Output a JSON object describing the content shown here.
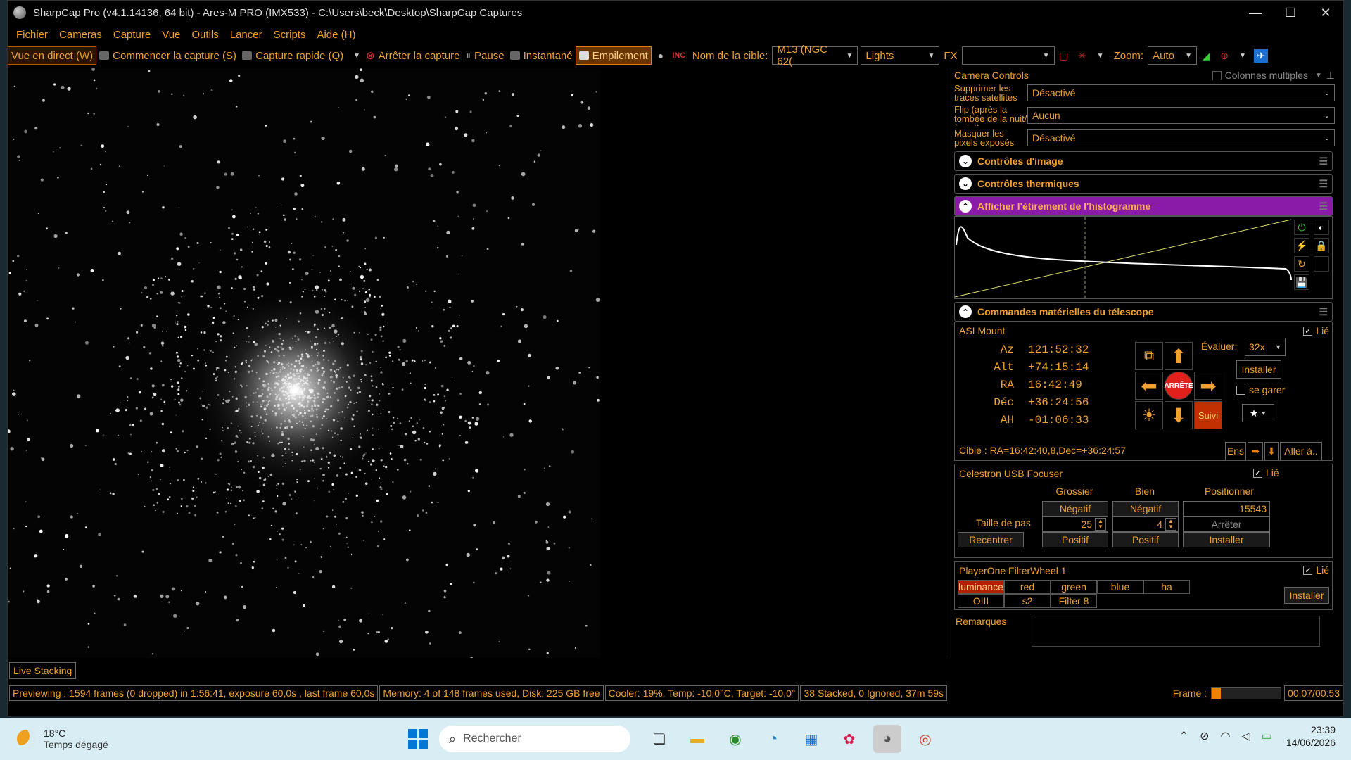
{
  "window": {
    "title": "SharpCap Pro (v4.1.14136, 64 bit) - Ares-M PRO (IMX533) - C:\\Users\\beck\\Desktop\\SharpCap Captures",
    "minimize": "—",
    "maximize": "☐",
    "close": "✕"
  },
  "menu": [
    "Fichier",
    "Cameras",
    "Capture",
    "Vue",
    "Outils",
    "Lancer",
    "Scripts",
    "Aide (H)"
  ],
  "toolbar": {
    "live_view": "Vue en direct (W)",
    "start_capture": "Commencer la capture (S)",
    "quick_capture": "Capture rapide (Q)",
    "stop_capture": "Arrêter la capture",
    "pause": "Pause",
    "snapshot": "Instantané",
    "stacking": "Empilement",
    "target_label": "Nom de la cible:",
    "target_value": "M13 (NGC 62(",
    "frame_type": "Lights",
    "fx_label": "FX",
    "fx_value": "",
    "zoom_label": "Zoom:",
    "zoom_value": "Auto"
  },
  "panel": {
    "title": "Camera Controls",
    "multi_columns": "Colonnes multiples",
    "settings": [
      {
        "label": "Supprimer les traces satellites",
        "value": "Désactivé"
      },
      {
        "label": "Flip (après la tombée de la nuit/à plat)",
        "value": "Aucun"
      },
      {
        "label": "Masquer les pixels exposés",
        "value": "Désactivé"
      }
    ],
    "sections": {
      "image_controls": "Contrôles d'image",
      "thermal_controls": "Contrôles thermiques",
      "histogram": "Afficher l'étirement de l'histogramme",
      "telescope": "Commandes matérielles du télescope"
    }
  },
  "mount": {
    "name": "ASI Mount",
    "linked_label": "Lié",
    "coords": [
      {
        "key": "Az",
        "value": "121:52:32"
      },
      {
        "key": "Alt",
        "value": "+74:15:14"
      },
      {
        "key": "RA",
        "value": "16:42:49"
      },
      {
        "key": "Déc",
        "value": "+36:24:56"
      },
      {
        "key": "AH",
        "value": "-01:06:33"
      }
    ],
    "stop_label": "ARRÊTE",
    "tracking_label": "Suivi",
    "rate_label": "Évaluer:",
    "rate_value": "32x",
    "install": "Installer",
    "park_label": "se garer",
    "target": "Cible : RA=16:42:40,8,Dec=+36:24:57",
    "set_btn": "Ens",
    "goto_btn": "Aller à.."
  },
  "focuser": {
    "name": "Celestron USB Focuser",
    "linked_label": "Lié",
    "col_coarse": "Grossier",
    "col_fine": "Bien",
    "col_position": "Positionner",
    "negative": "Négatif",
    "positive": "Positif",
    "position_value": "15543",
    "step_label": "Taille de pas",
    "coarse_step": "25",
    "fine_step": "4",
    "stop": "Arrêter",
    "recenter": "Recentrer",
    "install": "Installer"
  },
  "filterwheel": {
    "name": "PlayerOne FilterWheel 1",
    "linked_label": "Lié",
    "filters": [
      "luminance",
      "red",
      "green",
      "blue",
      "ha",
      "OIII",
      "s2",
      "Filter 8"
    ],
    "selected": "luminance",
    "install": "Installer"
  },
  "remarks_label": "Remarques",
  "live_stacking": "Live Stacking",
  "status": {
    "preview": "Previewing : 1594 frames (0 dropped) in 1:56:41, exposure 60,0s , last frame 60,0s",
    "memory": "Memory: 4 of 148 frames used, Disk: 225 GB free",
    "cooler": "Cooler: 19%, Temp: -10,0°C, Target: -10,0°",
    "stacked": "38 Stacked, 0 Ignored, 37m 59s",
    "frame_label": "Frame :",
    "frame_progress": 0.13,
    "frame_time": "00:07/00:53"
  },
  "taskbar": {
    "temp": "18°C",
    "weather": "Temps dégagé",
    "search": "Rechercher",
    "time": "23:39",
    "date": "14/06/2026"
  }
}
